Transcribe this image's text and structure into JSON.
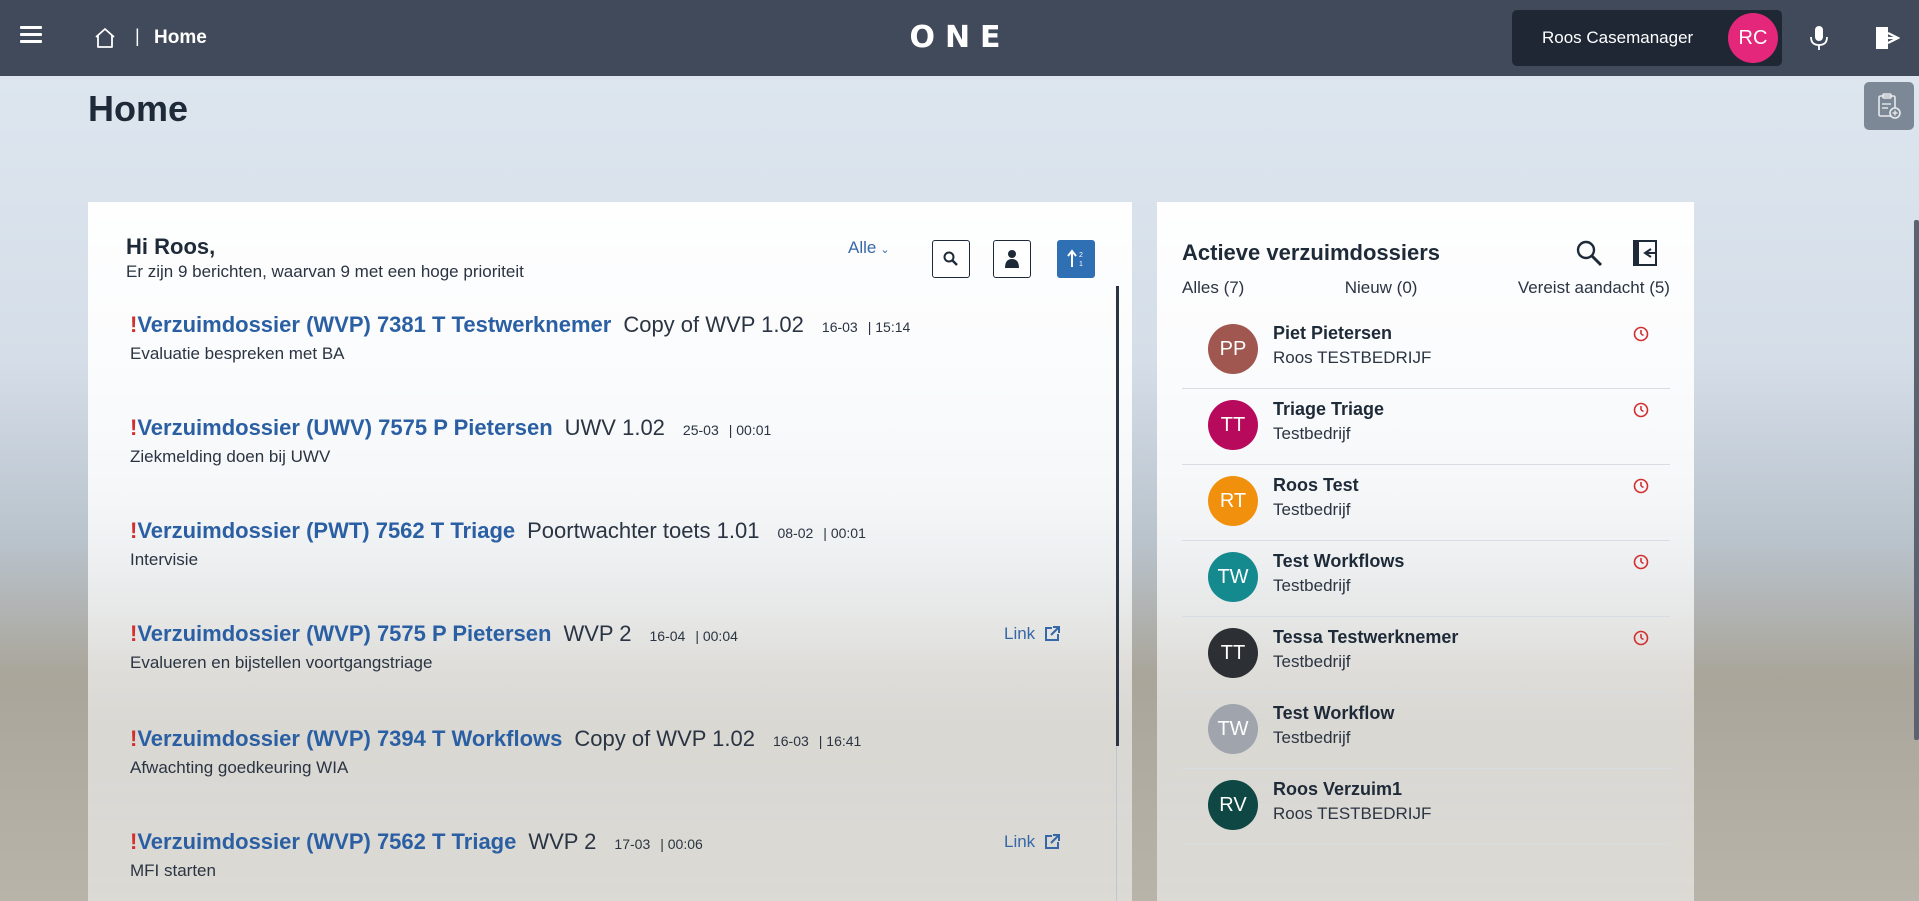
{
  "topbar": {
    "breadcrumb_sep": "|",
    "breadcrumb_current": "Home",
    "logo": "ONE",
    "user_name": "Roos Casemanager",
    "user_initials": "RC"
  },
  "page": {
    "title": "Home"
  },
  "messages_panel": {
    "greeting": "Hi Roos,",
    "subtitle": "Er zijn 9 berichten, waarvan 9 met een hoge prioriteit",
    "filter_label": "Alle",
    "items": [
      {
        "priority": "!",
        "title": "Verzuimdossier (WVP) 7381 T Testwerknemer",
        "type": "Copy of WVP 1.02",
        "date": "16-03",
        "time": "| 15:14",
        "description": "Evaluatie bespreken met BA",
        "link": ""
      },
      {
        "priority": "!",
        "title": "Verzuimdossier (UWV) 7575 P Pietersen",
        "type": "UWV 1.02",
        "date": "25-03",
        "time": "| 00:01",
        "description": "Ziekmelding doen bij UWV",
        "link": ""
      },
      {
        "priority": "!",
        "title": "Verzuimdossier (PWT) 7562 T Triage",
        "type": "Poortwachter toets 1.01",
        "date": "08-02",
        "time": "| 00:01",
        "description": "Intervisie",
        "link": ""
      },
      {
        "priority": "!",
        "title": "Verzuimdossier (WVP) 7575 P Pietersen",
        "type": "WVP 2",
        "date": "16-04",
        "time": "| 00:04",
        "description": "Evalueren en bijstellen voortgangstriage",
        "link": "Link"
      },
      {
        "priority": "!",
        "title": "Verzuimdossier (WVP) 7394 T Workflows",
        "type": "Copy of WVP 1.02",
        "date": "16-03",
        "time": "| 16:41",
        "description": "Afwachting goedkeuring WIA",
        "link": ""
      },
      {
        "priority": "!",
        "title": "Verzuimdossier (WVP) 7562 T Triage",
        "type": "WVP 2",
        "date": "17-03",
        "time": "| 00:06",
        "description": "MFI starten",
        "link": "Link"
      }
    ]
  },
  "dossiers_panel": {
    "title": "Actieve verzuimdossiers",
    "tabs": [
      "Alles (7)",
      "Nieuw (0)",
      "Vereist aandacht (5)"
    ],
    "items": [
      {
        "initials": "PP",
        "name": "Piet Pietersen",
        "company": "Roos TESTBEDRIJF",
        "color": "#a0574f",
        "attention": true
      },
      {
        "initials": "TT",
        "name": "Triage Triage",
        "company": "Testbedrijf",
        "color": "#b80a5d",
        "attention": true
      },
      {
        "initials": "RT",
        "name": "Roos Test",
        "company": "Testbedrijf",
        "color": "#f1900c",
        "attention": true
      },
      {
        "initials": "TW",
        "name": "Test Workflows",
        "company": "Testbedrijf",
        "color": "#148a8f",
        "attention": true
      },
      {
        "initials": "TT",
        "name": "Tessa Testwerknemer",
        "company": "Testbedrijf",
        "color": "#2c2f33",
        "attention": true
      },
      {
        "initials": "TW",
        "name": "Test Workflow",
        "company": "Testbedrijf",
        "color": "#9fa4ad",
        "attention": false
      },
      {
        "initials": "RV",
        "name": "Roos Verzuim1",
        "company": "Roos TESTBEDRIJF",
        "color": "#0f4745",
        "attention": false
      }
    ]
  },
  "colors": {
    "topbar": "#414a5a",
    "accent_blue": "#2b5fa3",
    "priority_red": "#d32f2f",
    "user_avatar": "#e5277b"
  }
}
